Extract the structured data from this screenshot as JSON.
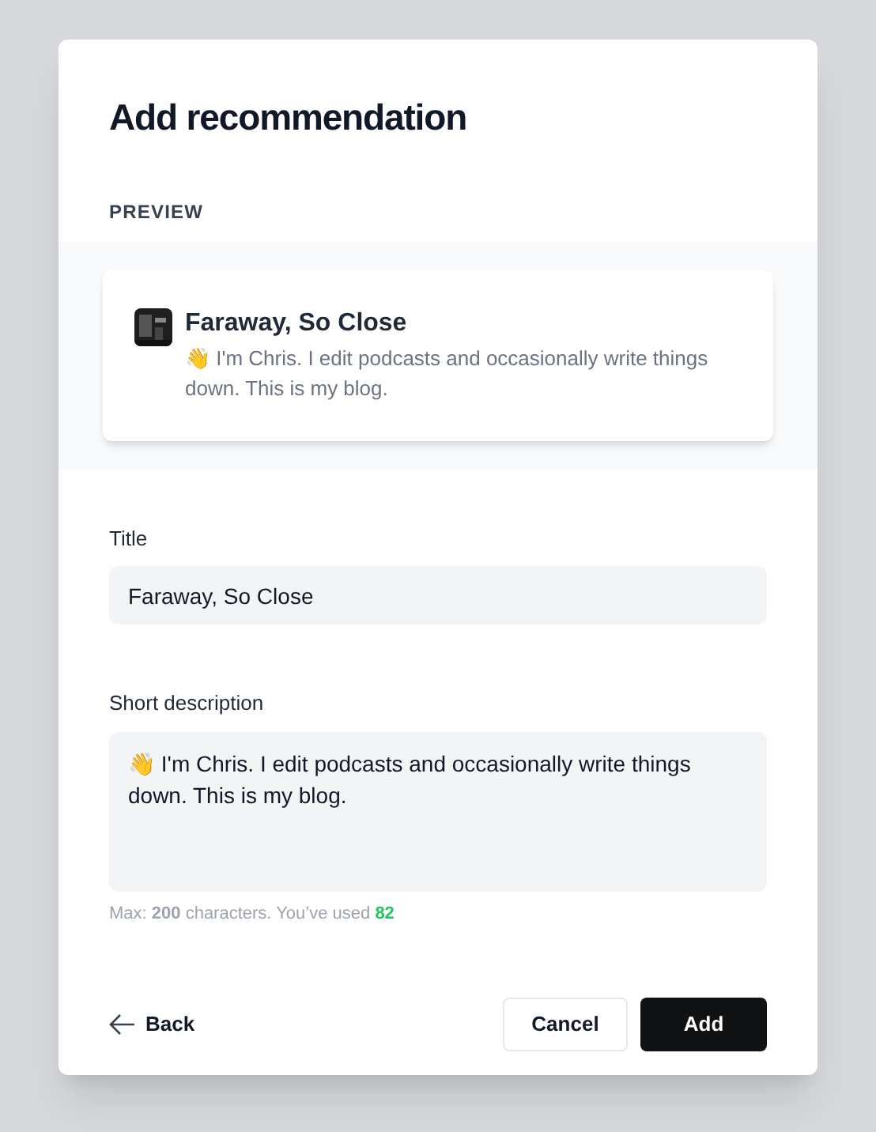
{
  "dialog": {
    "title": "Add recommendation",
    "preview": {
      "label": "PREVIEW",
      "card": {
        "title": "Faraway, So Close",
        "description": "👋 I'm Chris. I edit podcasts and occasionally write things down. This is my blog."
      }
    },
    "fields": [
      {
        "label": "Title",
        "value": "Faraway, So Close",
        "kind": "input"
      },
      {
        "label": "Short description",
        "value": "👋 I'm Chris. I edit podcasts and occasionally write things down. This is my blog.",
        "kind": "textarea"
      }
    ],
    "helper": {
      "text": "Max: **200** characters. You’ve used",
      "count": "82"
    },
    "back": "Back",
    "buttons": [
      {
        "label": "Cancel",
        "kind": "secondary"
      },
      {
        "label": "Add",
        "kind": "primary"
      }
    ]
  }
}
